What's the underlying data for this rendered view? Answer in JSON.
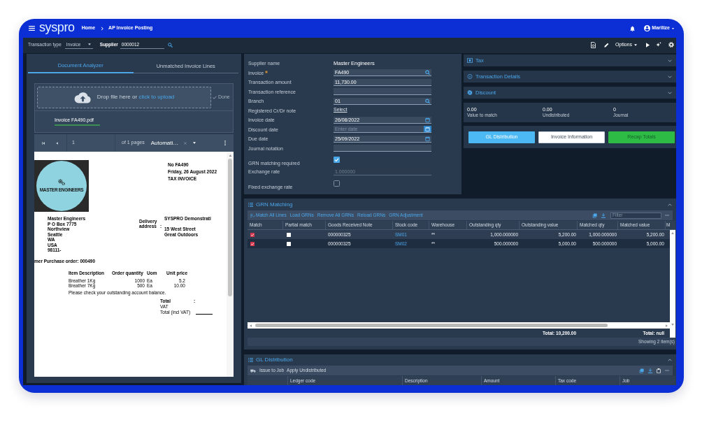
{
  "header": {
    "logo": "syspro",
    "breadcrumbs": [
      "Home",
      "AP Invoice Posting"
    ],
    "user": "Marilize"
  },
  "toolbar": {
    "fields": [
      {
        "label": "Transaction type",
        "kind": "select",
        "value": "Invoice"
      },
      {
        "label": "Supplier",
        "kind": "lookup",
        "value": "0000012"
      }
    ],
    "options": "Options"
  },
  "document_panel": {
    "tabs": [
      {
        "label": "Document Analyzer",
        "selected": true
      },
      {
        "label": "Unmatched Invoice Lines",
        "selected": false
      }
    ],
    "upload": {
      "prompt": "Drop file here or",
      "link": "click to upload",
      "done": "Done",
      "done_disabled": true
    },
    "file": {
      "name": "Invoice FA490.pdf",
      "uploaded": true
    },
    "viewer": {
      "page": "1",
      "page_count": "of 1 pages",
      "zoom": "Automati…"
    },
    "document": {
      "logo_text": "MASTER ENGINEERS",
      "heading": [
        "No FA490",
        "Friday, 26 August 2022",
        "TAX INVOICE"
      ],
      "supplier_address": [
        "Master Engineers",
        "P O Box 7775",
        "Northview",
        "Seattle",
        "WA",
        "USA",
        "98111-"
      ],
      "delivery_label": "Delivery address",
      "delivery_separator": ":",
      "delivery_address": [
        "SYSPRO Demonstrati",
        "15 West Street",
        "Great Outdoors"
      ],
      "purchase_order": "mer Purchase order: 000490",
      "items": {
        "columns": [
          "Item Description",
          "Order quantity",
          "Uom",
          "Unit price"
        ],
        "rows": [
          [
            "Breather 1Kg",
            "1000",
            "Ea",
            "5.2"
          ],
          [
            "Breather 7Kg",
            "500",
            "Ea",
            "10.00"
          ]
        ]
      },
      "note": "Please check your outstanding account balance.",
      "totals": [
        "Total",
        "VAT",
        "Total (incl VAT)"
      ],
      "total_separator": ":"
    }
  },
  "form": [
    {
      "label": "Supplier name",
      "kind": "text",
      "value": "Master Engineers",
      "required": false,
      "disabled": false,
      "focused": false
    },
    {
      "label": "Invoice",
      "kind": "lookup",
      "value": "FA490",
      "required": true,
      "disabled": false,
      "focused": false
    },
    {
      "label": "Transaction amount",
      "kind": "input",
      "value": "11,730.00",
      "required": false,
      "disabled": false,
      "focused": false
    },
    {
      "label": "Transaction reference",
      "kind": "input",
      "required": false,
      "disabled": false,
      "focused": false
    },
    {
      "label": "Branch",
      "kind": "lookup",
      "value": "01",
      "required": false,
      "disabled": false,
      "focused": false
    },
    {
      "label": "Registered Cr/Dr note",
      "kind": "link",
      "value": "Select",
      "required": false,
      "disabled": false,
      "focused": false
    },
    {
      "label": "Invoice date",
      "kind": "date",
      "value": "26/08/2022",
      "required": false,
      "disabled": false,
      "focused": false
    },
    {
      "label": "Discount date",
      "kind": "date",
      "placeholder": "Enter date",
      "required": false,
      "disabled": false,
      "focused": true
    },
    {
      "label": "Due date",
      "kind": "date",
      "value": "25/09/2022",
      "required": false,
      "disabled": false,
      "focused": false
    },
    {
      "label": "Journal notation",
      "kind": "input",
      "required": false,
      "disabled": false,
      "focused": false
    },
    {
      "label": "GRN matching required",
      "kind": "checkbox",
      "checked": true,
      "required": false,
      "disabled": false,
      "focused": false
    },
    {
      "label": "Exchange rate",
      "kind": "input",
      "value": "1.000000",
      "required": false,
      "disabled": true,
      "focused": false
    },
    {
      "label": "Fixed exchange rate",
      "kind": "checkbox",
      "checked": false,
      "required": false,
      "disabled": false,
      "focused": false
    }
  ],
  "sections": [
    {
      "title": "Tax",
      "expanded": false
    },
    {
      "title": "Transaction Details",
      "expanded": false
    },
    {
      "title": "Discount",
      "expanded": false
    }
  ],
  "summary": [
    {
      "value": "0.00",
      "label": "Value to match"
    },
    {
      "value": "0.00",
      "label": "Undistributed"
    },
    {
      "value": "0",
      "label": "Journal"
    }
  ],
  "actions": [
    {
      "label": "GL Distribution",
      "kind": "primary"
    },
    {
      "label": "Invoice Information",
      "kind": "secondary"
    },
    {
      "label": "Recap Totals",
      "kind": "success"
    }
  ],
  "grn_matching": {
    "title": "GRN Matching",
    "expanded": true,
    "actions": [
      "Match All Lines",
      "Load GRNs",
      "Remove All GRNs",
      "Reload GRNs",
      "GRN Adjustment"
    ],
    "filter_placeholder": "Filter",
    "columns": [
      "Match",
      "Partial match",
      "Goods Received Note",
      "Stock code",
      "Warehouse",
      "Outstanding qty",
      "Outstanding value",
      "Matched qty",
      "Matched value",
      "M"
    ],
    "rows": [
      {
        "match": true,
        "partial_match": false,
        "grn": "000000325",
        "stock_code": "SM01",
        "warehouse": "**",
        "outstanding_qty": "1,000.000000",
        "outstanding_value": "5,200.00",
        "matched_qty": "1,000.000000",
        "matched_value": "5,200.00"
      },
      {
        "match": true,
        "partial_match": false,
        "grn": "000000325",
        "stock_code": "SM02",
        "warehouse": "**",
        "outstanding_qty": "500.000000",
        "outstanding_value": "5,000.00",
        "matched_qty": "500.000000",
        "matched_value": "5,000.00"
      }
    ],
    "totals": {
      "outstanding_value": "Total: 10,200.00",
      "matched_value": "Total: null"
    },
    "footer": "Showing 2 item(s)"
  },
  "gl_distribution": {
    "title": "GL Distribution",
    "expanded": true,
    "actions": [
      "Issue to Job",
      "Apply Undistributed"
    ],
    "columns": [
      "Ledger code",
      "Description",
      "Amount",
      "Tax code",
      "Job"
    ]
  }
}
